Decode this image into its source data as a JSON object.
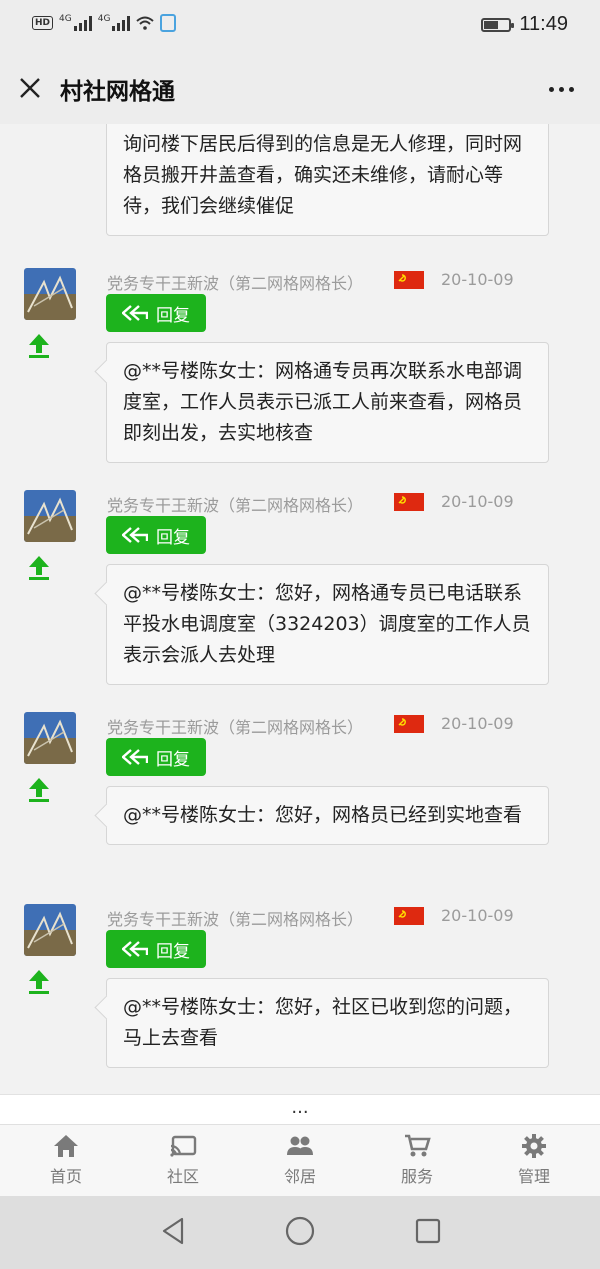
{
  "status_bar": {
    "hd": "HD",
    "net1": "4G",
    "net2": "4G",
    "time": "11:49"
  },
  "header": {
    "title": "村社网格通"
  },
  "first_bubble": {
    "text": "@**号楼陈女士：网格员已到，未见维修人员，询问楼下居民后得到的信息是无人修理，同时网格员搬开井盖查看，确实还未维修，请耐心等待，我们会继续催促"
  },
  "messages": [
    {
      "author": "党务专干王新波（第二网格网格长）",
      "date": "20-10-09",
      "reply_label": "回复",
      "text": "@**号楼陈女士：网格通专员再次联系水电部调度室，工作人员表示已派工人前来查看，网格员即刻出发，去实地核查"
    },
    {
      "author": "党务专干王新波（第二网格网格长）",
      "date": "20-10-09",
      "reply_label": "回复",
      "text": "@**号楼陈女士：您好，网格通专员已电话联系平投水电调度室（3324203）调度室的工作人员表示会派人去处理"
    },
    {
      "author": "党务专干王新波（第二网格网格长）",
      "date": "20-10-09",
      "reply_label": "回复",
      "text": "@**号楼陈女士：您好，网格员已经到实地查看"
    },
    {
      "author": "党务专干王新波（第二网格网格长）",
      "date": "20-10-09",
      "reply_label": "回复",
      "text": "@**号楼陈女士：您好，社区已收到您的问题，马上去查看"
    }
  ],
  "load_more": "...",
  "tabs": [
    {
      "label": "首页",
      "icon": "home-icon"
    },
    {
      "label": "社区",
      "icon": "cast-icon"
    },
    {
      "label": "邻居",
      "icon": "people-icon"
    },
    {
      "label": "服务",
      "icon": "cart-icon"
    },
    {
      "label": "管理",
      "icon": "gear-icon"
    }
  ]
}
